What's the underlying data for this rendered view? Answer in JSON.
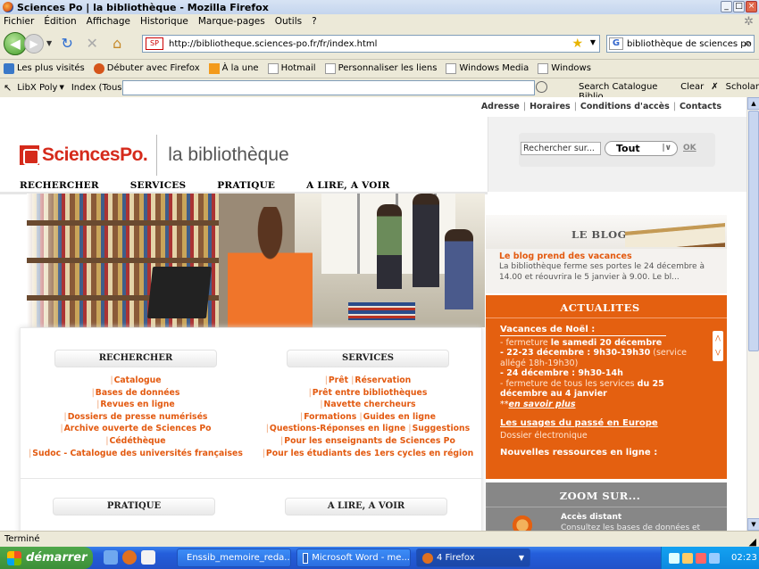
{
  "window": {
    "title": "Sciences Po | la bibliothèque - Mozilla Firefox"
  },
  "menu": [
    "Fichier",
    "Édition",
    "Affichage",
    "Historique",
    "Marque-pages",
    "Outils",
    "?"
  ],
  "nav": {
    "url": "http://bibliotheque.sciences-po.fr/fr/index.html",
    "search_value": "bibliothèque de sciences po"
  },
  "bookmarks": [
    "Les plus visités",
    "Débuter avec Firefox",
    "À la une",
    "Hotmail",
    "Personnaliser les liens",
    "Windows Media",
    "Windows"
  ],
  "libx": {
    "name": "LibX Poly",
    "index": "Index (Tous)",
    "search_catalogue": "Search Catalogue Biblio",
    "clear": "Clear",
    "scholar": "Scholar"
  },
  "site": {
    "top_links": [
      "Adresse",
      "Horaires",
      "Conditions d'accès",
      "Contacts"
    ],
    "logo_text": "SciencesPo.",
    "subtitle": "la bibliothèque",
    "search_placeholder": "Rechercher sur...",
    "search_scope": "Tout",
    "search_ok": "OK",
    "main_nav": [
      "RECHERCHER",
      "SERVICES",
      "PRATIQUE",
      "A LIRE, A VOIR"
    ],
    "rechercher": {
      "title": "RECHERCHER",
      "links": [
        [
          "Catalogue"
        ],
        [
          "Bases de données"
        ],
        [
          "Revues en ligne"
        ],
        [
          "Dossiers de presse numérisés"
        ],
        [
          "Archive ouverte de Sciences Po"
        ],
        [
          "Cédéthèque"
        ],
        [
          "Sudoc - Catalogue des universités françaises"
        ]
      ]
    },
    "services": {
      "title": "SERVICES",
      "links": [
        [
          "Prêt",
          "Réservation"
        ],
        [
          "Prêt entre bibliothèques"
        ],
        [
          "Navette chercheurs"
        ],
        [
          "Formations",
          "Guides en ligne"
        ],
        [
          "Questions-Réponses en ligne",
          "Suggestions"
        ],
        [
          "Pour les enseignants de Sciences Po"
        ],
        [
          "Pour les étudiants des 1ers cycles en région"
        ]
      ]
    },
    "pratique_title": "PRATIQUE",
    "alire_title": "A LIRE, A VOIR",
    "blog": {
      "title": "LE BLOG",
      "post_title": "Le blog prend des vacances",
      "post_body": "La bibliothèque ferme ses portes le 24 décembre à 14.00 et réouvrira le 5 janvier à 9.00. Le bl..."
    },
    "actualites": {
      "title": "ACTUALITES",
      "heading": "Vacances de Noël :",
      "l1_pre": "- fermeture ",
      "l1_b": "le samedi 20 décembre",
      "l2_b": "- 22-23 décembre : 9h30-19h30",
      "l2_post": " (service allégé 18h-19h30)",
      "l3_b": "- 24 décembre : 9h30-14h",
      "l4_pre": "- fermeture de tous les services ",
      "l4_b": "du 25 décembre au 4 janvier",
      "more_prefix": "**",
      "more": "en savoir plus",
      "h2": "Les usages du passé en Europe",
      "h2_sub": "Dossier électronique",
      "h3": "Nouvelles ressources en ligne :"
    },
    "zoom": {
      "title": "ZOOM SUR...",
      "item_title": "Accès distant",
      "item_body": "Consultez les bases de données et"
    }
  },
  "status": "Terminé",
  "taskbar": {
    "start": "démarrer",
    "items": [
      "Enssib_memoire_reda...",
      "Microsoft Word - me...",
      "4 Firefox"
    ],
    "clock": "02:23"
  }
}
